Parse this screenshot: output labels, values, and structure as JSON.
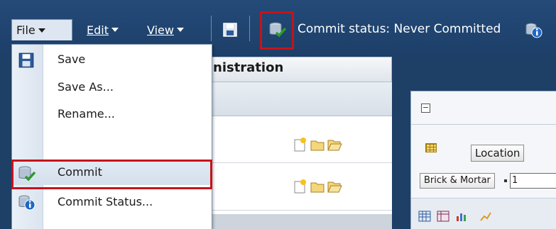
{
  "menubar": {
    "file_label": "File",
    "edit_label": "Edit",
    "view_label": "View",
    "commit_status": "Commit status: Never Committed"
  },
  "file_menu": {
    "items": [
      {
        "label": "Save",
        "icon": "floppy-disk-icon"
      },
      {
        "label": "Save As...",
        "icon": ""
      },
      {
        "label": "Rename...",
        "icon": ""
      },
      {
        "label": "Commit",
        "icon": "commit-database-icon"
      },
      {
        "label": "Commit Status...",
        "icon": "commit-status-icon"
      }
    ]
  },
  "background": {
    "admin_title": "nistration",
    "location_button": "Location",
    "brick_mortar": "Brick & Mortar",
    "brick_value": "1"
  },
  "colors": {
    "menubar": "#1e3f66",
    "highlight": "#c4141b",
    "menu_bg": "#ffffff"
  }
}
